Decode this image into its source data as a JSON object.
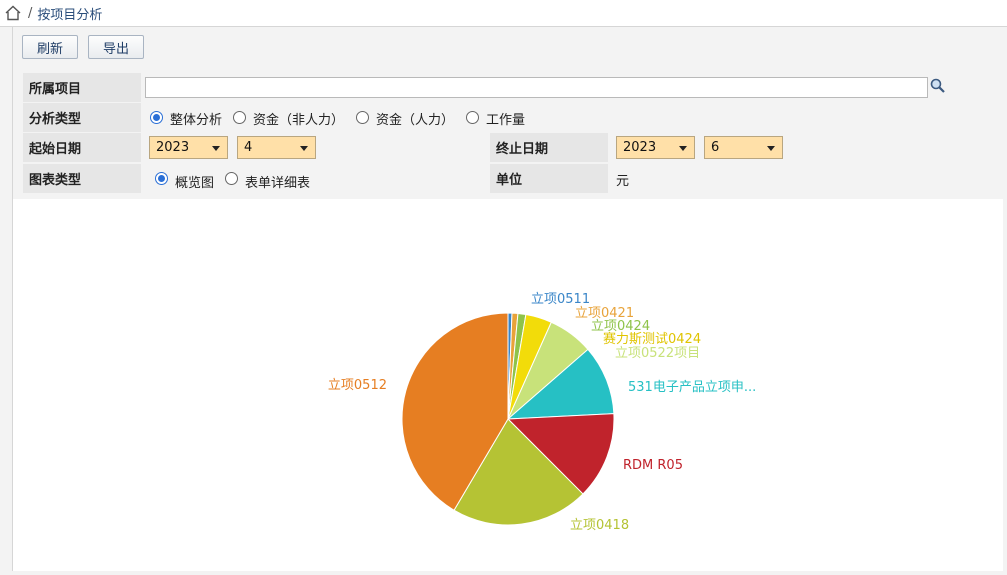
{
  "breadcrumb": {
    "separator": "/",
    "current": "按项目分析"
  },
  "toolbar": {
    "refresh_label": "刷新",
    "export_label": "导出"
  },
  "form": {
    "project_label": "所属项目",
    "project_value": "",
    "analysis_type_label": "分析类型",
    "analysis_options": [
      "整体分析",
      "资金（非人力）",
      "资金（人力）",
      "工作量"
    ],
    "analysis_selected": "整体分析",
    "start_date_label": "起始日期",
    "start_year": "2023",
    "start_month": "4",
    "end_date_label": "终止日期",
    "end_year": "2023",
    "end_month": "6",
    "chart_type_label": "图表类型",
    "chart_options": [
      "概览图",
      "表单详细表"
    ],
    "chart_selected": "概览图",
    "unit_label": "单位",
    "unit_value": "元"
  },
  "chart_data": {
    "type": "pie",
    "title": "",
    "slices": [
      {
        "label": "立项0511",
        "value": 0.6,
        "color": "#3a86c8"
      },
      {
        "label": "立项0421",
        "value": 0.9,
        "color": "#e8a33a"
      },
      {
        "label": "立项0424",
        "value": 1.2,
        "color": "#8fc34a"
      },
      {
        "label": "赛力斯测试0424",
        "value": 4.0,
        "color": "#f2dc0a"
      },
      {
        "label": "立项0522项目",
        "value": 6.9,
        "color": "#c8e27a"
      },
      {
        "label": "531电子产品立项申...",
        "value": 10.6,
        "color": "#26c0c4"
      },
      {
        "label": "RDM R05",
        "value": 13.3,
        "color": "#c0232c"
      },
      {
        "label": "立项0418",
        "value": 21.0,
        "color": "#b5c334"
      },
      {
        "label": "立项0512",
        "value": 41.5,
        "color": "#e67e22"
      }
    ]
  }
}
